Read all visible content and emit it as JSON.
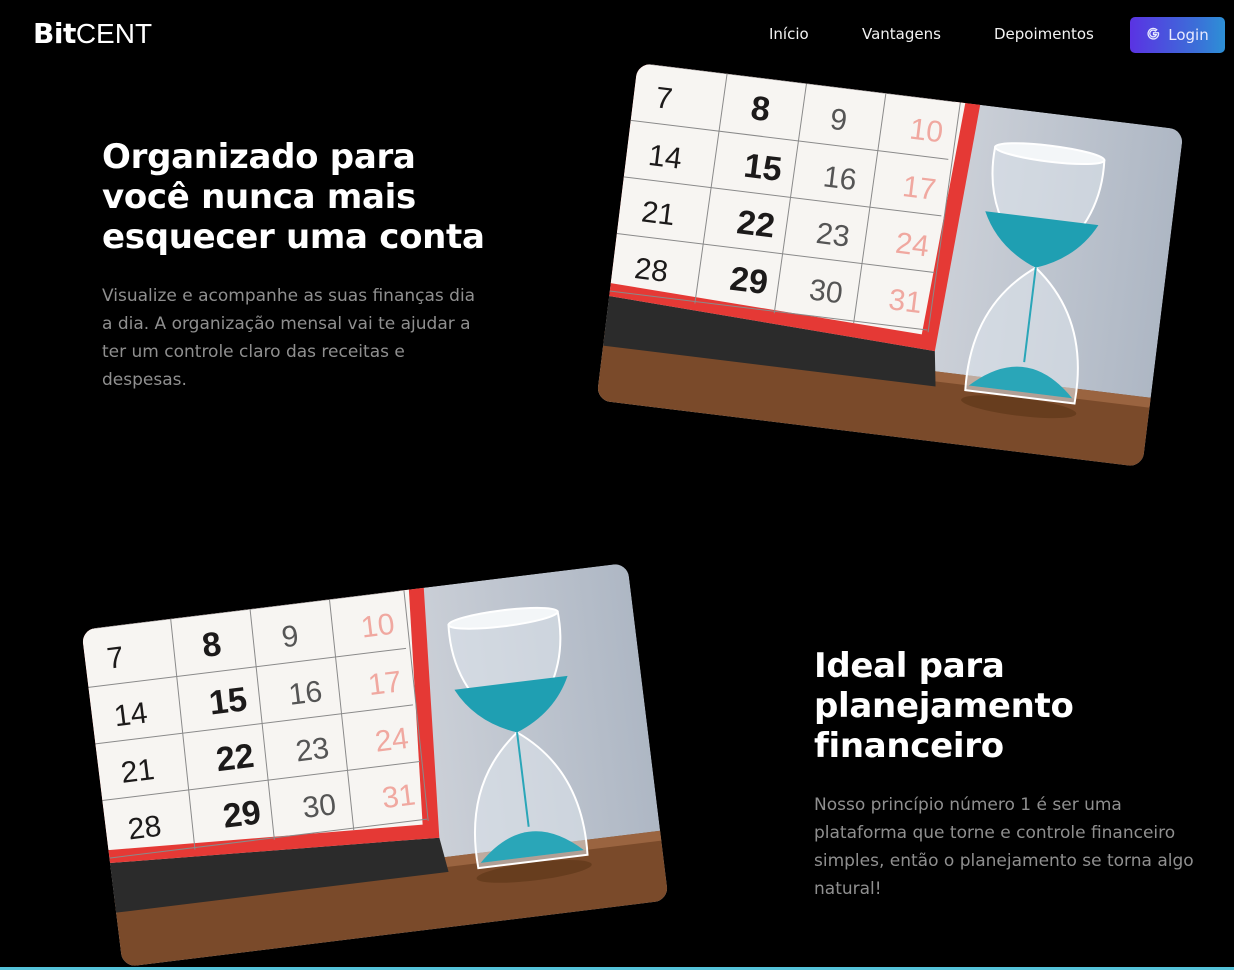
{
  "header": {
    "logo_bold": "Bit",
    "logo_light": "CENT",
    "nav": [
      "Início",
      "Vantagens",
      "Depoimentos"
    ],
    "login_label": "Login",
    "login_icon": "google-g-icon"
  },
  "sections": [
    {
      "title_lines": [
        "Organizado para",
        "você nunca mais",
        "esquecer uma conta"
      ],
      "paragraph_lines": [
        "Visualize e acompanhe as suas finanças dia",
        "a dia. A organização mensal vai te ajudar a",
        "ter um controle claro das receitas e",
        "despesas."
      ],
      "image": "calendar-hourglass-photo"
    },
    {
      "title_lines": [
        "Ideal para",
        "planejamento",
        "financeiro"
      ],
      "paragraph_lines": [
        "Nosso princípio número 1 é ser uma",
        "plataforma que torne e controle financeiro",
        "simples, então o planejamento se torna algo",
        "natural!"
      ],
      "image": "calendar-hourglass-photo"
    }
  ],
  "calendar_numbers": [
    [
      "7",
      "8",
      "9",
      "10"
    ],
    [
      "14",
      "15",
      "16",
      "17"
    ],
    [
      "21",
      "22",
      "23",
      "24"
    ],
    [
      "28",
      "29",
      "30",
      "31"
    ]
  ],
  "colors": {
    "background": "#000000",
    "accent_start": "#5a33e3",
    "accent_end": "#2d90d6",
    "sand": "#2aa6b8",
    "calendar_red": "#e53935"
  }
}
